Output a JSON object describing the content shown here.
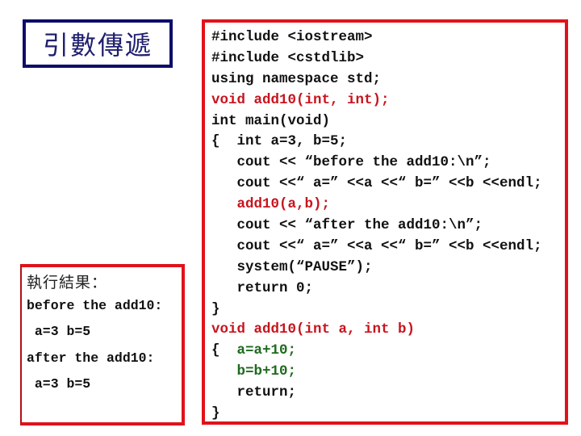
{
  "title": "引數傳遞",
  "code": {
    "lines": [
      {
        "text": "#include <iostream>",
        "color": "black"
      },
      {
        "text": "#include <cstdlib>",
        "color": "black"
      },
      {
        "text": "using namespace std;",
        "color": "black"
      },
      {
        "text": "void add10(int, int);",
        "color": "red"
      },
      {
        "text": "int main(void)",
        "color": "black"
      },
      {
        "text": "{  int a=3, b=5;",
        "color": "black"
      },
      {
        "text": "   cout << “before the add10:\\n”;",
        "color": "black"
      },
      {
        "text": "   cout <<“ a=” <<a <<“ b=” <<b <<endl;",
        "color": "black"
      },
      {
        "text": "   add10(a,b);",
        "color": "red"
      },
      {
        "text": "   cout << “after the add10:\\n”;",
        "color": "black"
      },
      {
        "text": "   cout <<“ a=” <<a <<“ b=” <<b <<endl;",
        "color": "black"
      },
      {
        "text": "   system(“PAUSE”);",
        "color": "black"
      },
      {
        "text": "   return 0;",
        "color": "black"
      },
      {
        "text": "}",
        "color": "black"
      },
      {
        "text": "void add10(int a, int b)",
        "color": "red"
      },
      {
        "text": "{  a=a+10;",
        "color": "mixed-green"
      },
      {
        "text": "   b=b+10;",
        "color": "green"
      },
      {
        "text": "   return;",
        "color": "black"
      },
      {
        "text": "}",
        "color": "black"
      }
    ],
    "line_15_prefix": "{  ",
    "line_15_body": "a=a+10;"
  },
  "output": {
    "heading": "執行結果：",
    "lines": [
      {
        "text": "before the add10:",
        "color": "black"
      },
      {
        "text": " a=3 b=5",
        "color": "black"
      },
      {
        "text": "after the add10:",
        "color": "black"
      },
      {
        "text": " a=3 b=5",
        "color": "red"
      }
    ]
  },
  "colors": {
    "title_border": "#0d0d6b",
    "code_border": "#e0121b",
    "highlight_red": "#c8141e",
    "highlight_green": "#1e6a1e"
  }
}
